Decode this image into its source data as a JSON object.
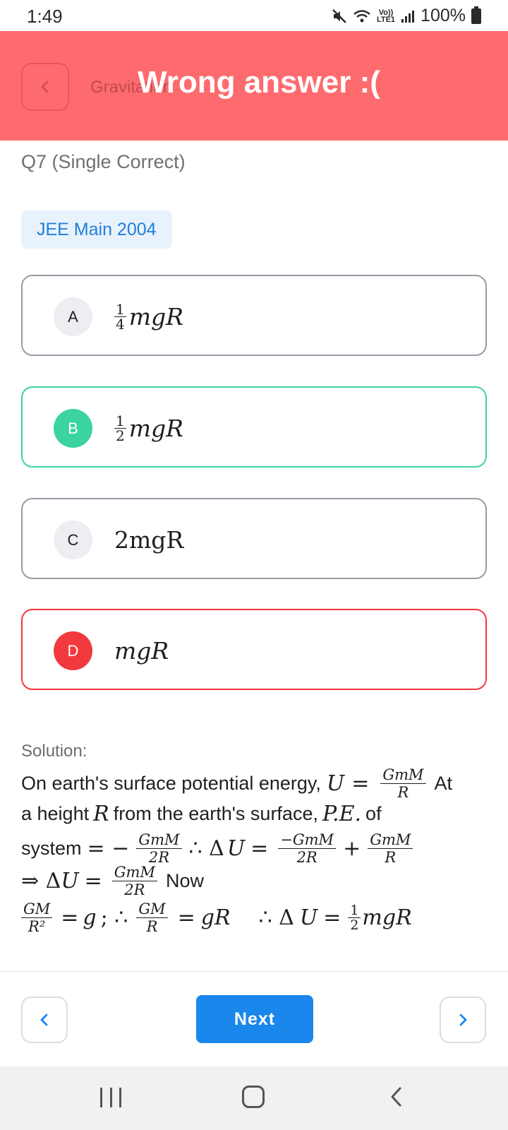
{
  "status_bar": {
    "time": "1:49",
    "lte_top": "Vo))",
    "lte_bottom": "LTE1",
    "battery_percent": "100%"
  },
  "header": {
    "topic_title": "Gravitation",
    "result_text": "Wrong answer :("
  },
  "question": {
    "type_label": "Q7 (Single Correct)",
    "exam_tag": "JEE Main 2004"
  },
  "options": [
    {
      "letter": "A",
      "state": "neutral",
      "frac_num": "1",
      "frac_den": "4",
      "expr": "mgR"
    },
    {
      "letter": "B",
      "state": "correct",
      "frac_num": "1",
      "frac_den": "2",
      "expr": "mgR"
    },
    {
      "letter": "C",
      "state": "neutral",
      "text": "2mgR"
    },
    {
      "letter": "D",
      "state": "wrong",
      "expr": "mgR"
    }
  ],
  "solution": {
    "label": "Solution:",
    "line1_text": "On earth's surface potential energy,",
    "line1_tail": "At",
    "line2_a": "a height",
    "line2_b": "from the earth's surface,",
    "line2_pe": "P.E.",
    "line2_c": "of",
    "line3_system": "system",
    "line4_now": "Now",
    "U": "U",
    "R": "R",
    "g": "g",
    "GmM": "GmM",
    "negGmM": "−GmM",
    "twoR": "2R",
    "GM": "GM",
    "R2": "R²",
    "gR": "gR",
    "mgR": "mgR",
    "one": "1",
    "two": "2"
  },
  "footer": {
    "next_label": "Next"
  },
  "colors": {
    "banner": "#fe6b6f",
    "correct": "#3cd49e",
    "wrong": "#f2393d",
    "accent": "#1a87ec",
    "chip_bg": "#e8f2fd"
  },
  "icons": {
    "back": "chevron-left-icon",
    "prev": "chevron-left-icon",
    "next": "chevron-right-icon",
    "mute": "mute-icon",
    "wifi": "wifi-icon",
    "signal": "signal-icon",
    "battery": "battery-icon"
  }
}
